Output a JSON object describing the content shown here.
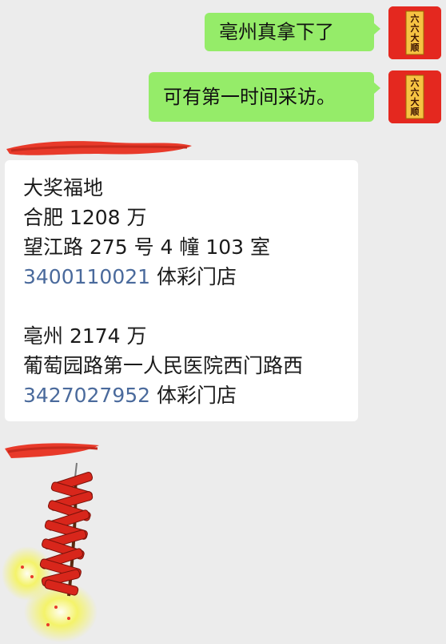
{
  "messages_out": [
    {
      "text": "亳州真拿下了"
    },
    {
      "text": "可有第一时间采访。"
    }
  ],
  "avatar": {
    "lines": [
      "六",
      "六",
      "大",
      "顺"
    ]
  },
  "card": {
    "lines": [
      {
        "text": "大奖福地"
      },
      {
        "text": "合肥 1208 万"
      },
      {
        "text": "望江路 275 号 4 幢 103 室"
      },
      {
        "link": "3400110021",
        "rest": " 体彩门店"
      },
      {
        "text": "亳州 2174 万"
      },
      {
        "text": "葡萄园路第一人民医院西门路西"
      },
      {
        "link": "3427027952",
        "rest": " 体彩门店"
      }
    ]
  },
  "colors": {
    "outgoing_bubble": "#95ec69",
    "link": "#4a6a9c",
    "redaction": "#e83a2a",
    "avatar_bg": "#e4281f",
    "background": "#ececec"
  },
  "icons": {
    "avatar": "liuliu-dashun-avatar-icon",
    "sticker": "firecracker-sticker-icon"
  }
}
